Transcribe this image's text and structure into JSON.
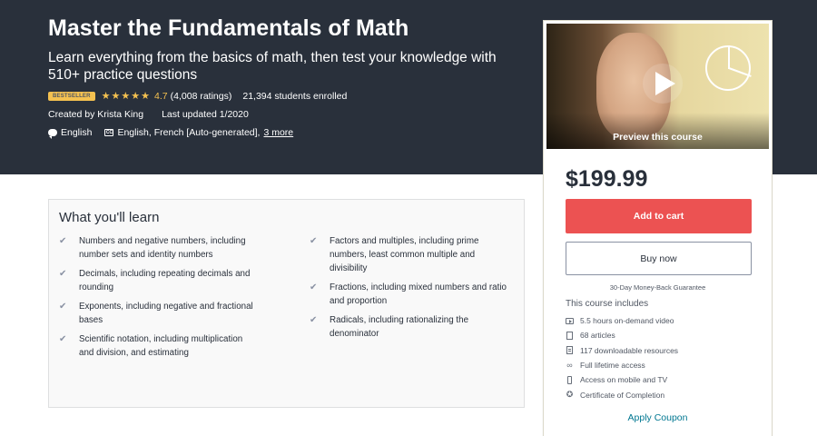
{
  "course": {
    "title": "Master the Fundamentals of Math",
    "subtitle": "Learn everything from the basics of math, then test your knowledge with 510+ practice questions",
    "badge": "Bestseller",
    "rating": "4.7",
    "ratings_count": "(4,008 ratings)",
    "students": "21,394 students enrolled",
    "created_by": "Created by Krista King",
    "last_updated": "Last updated 1/2020",
    "language": "English",
    "captions": "English, French [Auto-generated],",
    "captions_more": "3 more",
    "star_count": 5
  },
  "sidebar": {
    "preview_label": "Preview this course",
    "price": "$199.99",
    "add_to_cart": "Add to cart",
    "buy_now": "Buy now",
    "guarantee": "30-Day Money-Back Guarantee",
    "includes_heading": "This course includes",
    "includes": [
      {
        "icon": "video-icon",
        "label": "5.5 hours on-demand video"
      },
      {
        "icon": "article-icon",
        "label": "68 articles"
      },
      {
        "icon": "file-icon",
        "label": "117 downloadable resources"
      },
      {
        "icon": "infinity-icon",
        "label": "Full lifetime access"
      },
      {
        "icon": "mobile-icon",
        "label": "Access on mobile and TV"
      },
      {
        "icon": "trophy-icon",
        "label": "Certificate of Completion"
      }
    ],
    "apply_coupon": "Apply Coupon"
  },
  "learn": {
    "heading": "What you'll learn",
    "left": [
      "Numbers and negative numbers, including number sets and identity numbers",
      "Decimals, including repeating decimals and rounding",
      "Exponents, including negative and fractional bases",
      "Scientific notation, including multiplication and division, and estimating"
    ],
    "right": [
      "Factors and multiples, including prime numbers, least common multiple and divisibility",
      "Fractions, including mixed numbers and ratio and proportion",
      "Radicals, including rationalizing the denominator"
    ]
  },
  "colors": {
    "hero_bg": "#29303b",
    "accent_red": "#ec5252",
    "star_yellow": "#f4c150",
    "link_blue": "#007791"
  }
}
